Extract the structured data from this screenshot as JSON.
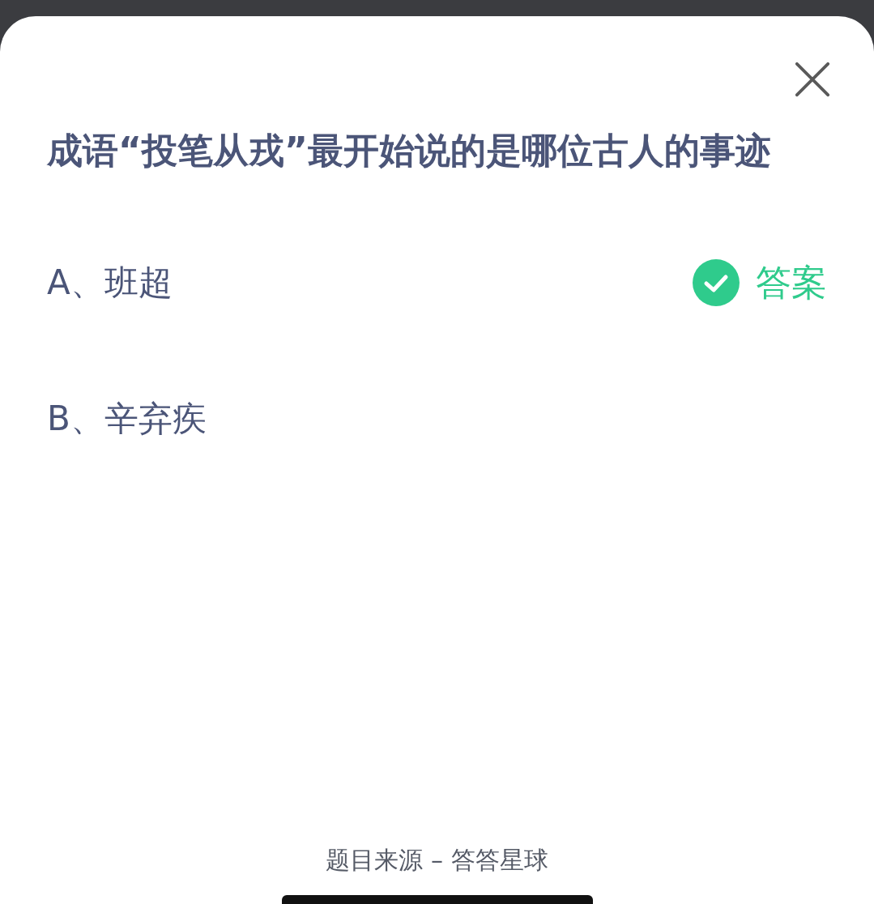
{
  "question": "成语“投笔从戎”最开始说的是哪位古人的事迹",
  "options": [
    {
      "label": "A、班超",
      "correct": true
    },
    {
      "label": "B、辛弃疾",
      "correct": false
    }
  ],
  "answer_label": "答案",
  "footer": "题目来源 – 答答星球"
}
